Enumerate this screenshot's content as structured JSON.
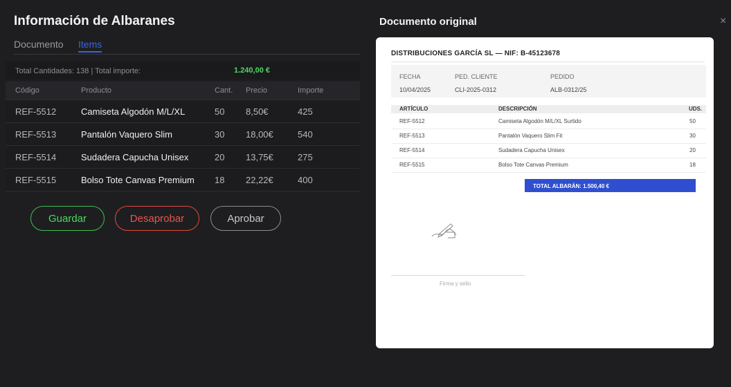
{
  "panel": {
    "title": "Información de Albaranes",
    "tabs": [
      {
        "label": "Documento",
        "active": false
      },
      {
        "label": "Items",
        "active": true
      }
    ],
    "totals_label": "Total Cantidades: 138 | Total importe:",
    "totals_amount": "1.240,00 €",
    "columns": [
      "Código",
      "Producto",
      "Cant.",
      "Precio",
      "Importe"
    ],
    "rows": [
      {
        "code": "REF-5512",
        "product": "Camiseta Algodón M/L/XL",
        "qty": "50",
        "price": "8,50€",
        "amount": "425"
      },
      {
        "code": "REF-5513",
        "product": "Pantalón Vaquero Slim",
        "qty": "30",
        "price": "18,00€",
        "amount": "540"
      },
      {
        "code": "REF-5514",
        "product": "Sudadera Capucha Unisex",
        "qty": "20",
        "price": "13,75€",
        "amount": "275"
      },
      {
        "code": "REF-5515",
        "product": "Bolso Tote Canvas Premium",
        "qty": "18",
        "price": "22,22€",
        "amount": "400"
      }
    ],
    "buttons": {
      "save": "Guardar",
      "reject": "Desaprobar",
      "approve": "Aprobar"
    }
  },
  "document": {
    "title": "Documento original",
    "close_icon": "×",
    "header": "DISTRIBUCIONES GARCÍA SL — NIF: B-45123678",
    "meta": [
      {
        "label": "FECHA",
        "value": "10/04/2025"
      },
      {
        "label": "PED. CLIENTE",
        "value": "CLI-2025-0312"
      },
      {
        "label": "PEDIDO",
        "value": "ALB-0312/25"
      }
    ],
    "item_columns": [
      "ARTÍCULO",
      "DESCRIPCIÓN",
      "UDS."
    ],
    "items": [
      {
        "ref": "REF-5512",
        "desc": "Camiseta Algodón M/L/XL Surtido",
        "units": "50"
      },
      {
        "ref": "REF-5513",
        "desc": "Pantalón Vaquero Slim Fit",
        "units": "30"
      },
      {
        "ref": "REF-5514",
        "desc": "Sudadera Capucha Unisex",
        "units": "20"
      },
      {
        "ref": "REF-5515",
        "desc": "Bolso Tote Canvas Premium",
        "units": "18"
      }
    ],
    "total": "TOTAL ALBARÁN: 1.500,40 €",
    "signature_label": "Firma y sello"
  },
  "colors": {
    "accent": "#3b63e0",
    "success": "#4cd964",
    "danger": "#e8564c",
    "total_bar": "#2f4fd0"
  }
}
